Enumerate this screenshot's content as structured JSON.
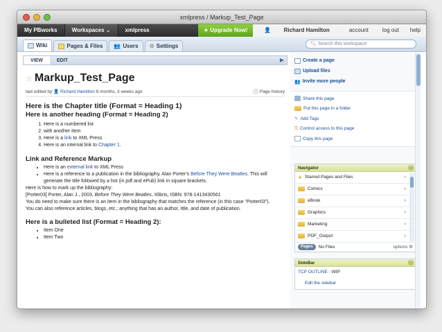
{
  "window": {
    "title": "xmlpress / Markup_Test_Page"
  },
  "topnav": {
    "my_pbworks": "My PBworks",
    "workspaces": "Workspaces ⌄",
    "workspace_name": "xmlpress",
    "upgrade": "Upgrade Now!",
    "user_name": "Richard Hamilton",
    "account": "account",
    "logout": "log out",
    "help": "help"
  },
  "tabs": [
    {
      "label": "Wiki",
      "icon": "wiki-icon"
    },
    {
      "label": "Pages & Files",
      "icon": "pages-files-icon"
    },
    {
      "label": "Users",
      "icon": "users-icon"
    },
    {
      "label": "Settings",
      "icon": "gear-icon"
    }
  ],
  "search": {
    "placeholder": "Search this workspace"
  },
  "editbar": {
    "view": "VIEW",
    "edit": "EDIT"
  },
  "page": {
    "title": "Markup_Test_Page",
    "last_edited_prefix": "last edited by",
    "editor": "Richard Hamilton",
    "edited_when": "8 months, 3 weeks ago",
    "history": "Page history",
    "h1": "Here is the Chapter title (Format = Heading 1)",
    "h2a": "Here is another heading (Format = Heading 2)",
    "ol": {
      "item1": "Here is a numbered list",
      "item2": "with another item",
      "item3_pre": "Here is a",
      "item3_link": "link",
      "item3_post": "to XML Press",
      "item4_pre": "Here is an internal link to",
      "item4_link": "Chapter 1",
      "item4_post": "."
    },
    "h2b": "Link and Reference Markup",
    "ul1": {
      "a_pre": "Here is an",
      "a_link": "external link",
      "a_post": "to XML Press",
      "b_pre": "Here is a reference to a publication in the bibliography, Alan Porter's",
      "b_link": "Before They Were Beatles",
      "b_post": ". This will generate the title followed by a hot (in pdf and ePub) link in square brackets."
    },
    "p1": "Here is how to mark up the bibliography:",
    "p2_pre": "[Porter03] Porter, Alan J., 2003,",
    "p2_italic": "Before They Were Beatles",
    "p2_post": ", Xlibris, ISBN: 978-1413430561",
    "p3": "You do need to make sure there is an item in the bibliography that matches the reference (in this case \"Porter03\").",
    "p4": "You can also reference articles, blogs, etc.; anything that has an author, title, and date of publication.",
    "h2c": "Here is a bulleted list (Format = Heading 2):",
    "ul2": [
      "Item One",
      "Item Two"
    ]
  },
  "sidebar": {
    "actions": [
      "Create a page",
      "Upload files",
      "Invite more people"
    ],
    "page_actions": [
      "Share this page",
      "Put this page in a folder",
      "Add Tags",
      "Control access to this page",
      "Copy this page"
    ],
    "navigator": {
      "title": "Navigator",
      "items": [
        "Starred Pages and Files",
        "Comics",
        "eBook",
        "Graphics",
        "Marketing",
        "PDF_Output"
      ],
      "pages_pill": "Pages",
      "no_files": "No Files",
      "options": "options"
    },
    "sidebar_panel": {
      "title": "SideBar",
      "tcp_link": "TCP OUTLINE",
      "tcp_suffix": "- WIP",
      "edit_link": "Edit the sidebar"
    }
  }
}
